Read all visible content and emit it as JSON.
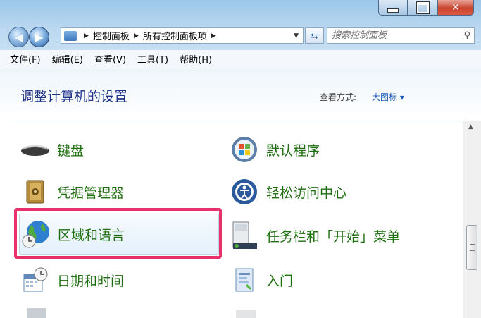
{
  "window": {
    "buttons": {
      "minimize": "—",
      "maximize": "□",
      "close": "✕"
    }
  },
  "nav": {
    "back_icon": "back-arrow-icon",
    "forward_icon": "forward-arrow-icon",
    "breadcrumb": [
      "控制面板",
      "所有控制面板项"
    ],
    "search_placeholder": "搜索控制面板"
  },
  "menubar": {
    "items": [
      "文件(F)",
      "编辑(E)",
      "查看(V)",
      "工具(T)",
      "帮助(H)"
    ]
  },
  "main": {
    "title": "调整计算机的设置",
    "view_by_label": "查看方式:",
    "view_by_value": "大图标 ▾"
  },
  "items": [
    {
      "label": "键盘",
      "icon": "keyboard-icon"
    },
    {
      "label": "默认程序",
      "icon": "default-programs-icon"
    },
    {
      "label": "凭据管理器",
      "icon": "credential-manager-icon"
    },
    {
      "label": "轻松访问中心",
      "icon": "ease-of-access-icon"
    },
    {
      "label": "区域和语言",
      "icon": "region-language-globe-icon"
    },
    {
      "label": "任务栏和「开始」菜单",
      "icon": "taskbar-start-menu-icon"
    },
    {
      "label": "日期和时间",
      "icon": "date-time-icon"
    },
    {
      "label": "入门",
      "icon": "getting-started-icon"
    }
  ],
  "colors": {
    "highlight_border": "#e8316b",
    "item_text": "#1f6e10",
    "title_text": "#1e3287"
  }
}
